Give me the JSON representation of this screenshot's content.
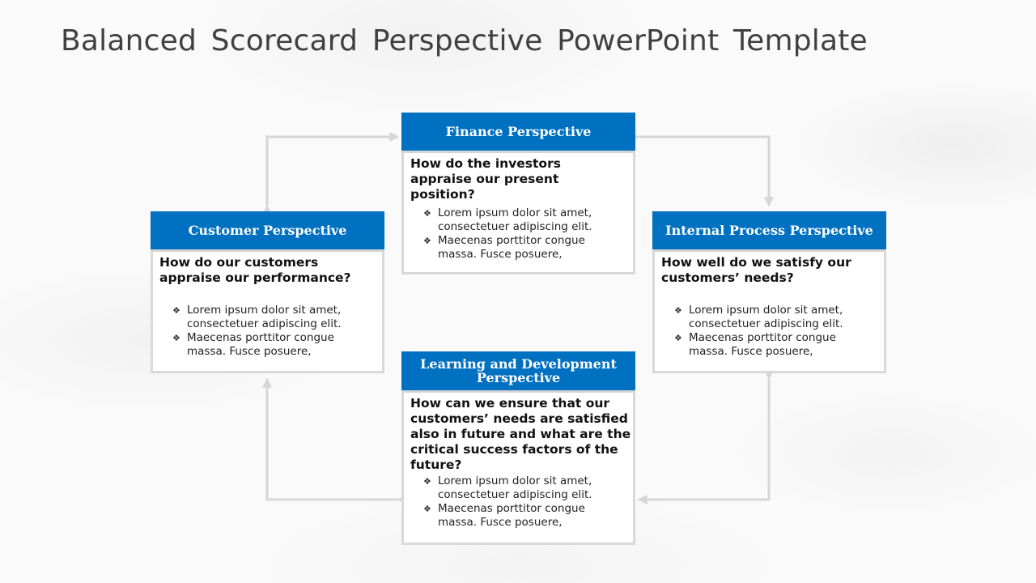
{
  "slide": {
    "title": "Balanced Scorecard Perspective PowerPoint Template",
    "accent_color": "#0070c0",
    "bullet_icon": "❖"
  },
  "cards": {
    "finance": {
      "header": "Finance Perspective",
      "question": "How do the investors appraise our present position?",
      "bullets": [
        "Lorem ipsum dolor sit amet, consectetuer adipiscing elit.",
        "Maecenas porttitor congue massa. Fusce posuere,"
      ]
    },
    "customer": {
      "header": "Customer Perspective",
      "question": "How do our customers appraise our performance?",
      "bullets": [
        "Lorem ipsum dolor sit amet, consectetuer adipiscing elit.",
        "Maecenas porttitor congue massa. Fusce posuere,"
      ]
    },
    "internal": {
      "header": "Internal Process Perspective",
      "question": "How well do we satisfy our customers’ needs?",
      "bullets": [
        "Lorem ipsum dolor sit amet, consectetuer adipiscing elit.",
        "Maecenas porttitor congue massa. Fusce posuere,"
      ]
    },
    "learning": {
      "header": "Learning and Development Perspective",
      "question": "How can we ensure that our customers’ needs are satisfied also in future and what are the critical success factors of the future?",
      "bullets": [
        "Lorem ipsum dolor sit amet, consectetuer adipiscing elit.",
        "Maecenas porttitor congue massa. Fusce posuere,"
      ]
    }
  },
  "connectors": [
    {
      "from": "customer",
      "to": "finance"
    },
    {
      "from": "finance",
      "to": "internal"
    },
    {
      "from": "internal",
      "to": "learning"
    },
    {
      "from": "learning",
      "to": "customer"
    }
  ]
}
